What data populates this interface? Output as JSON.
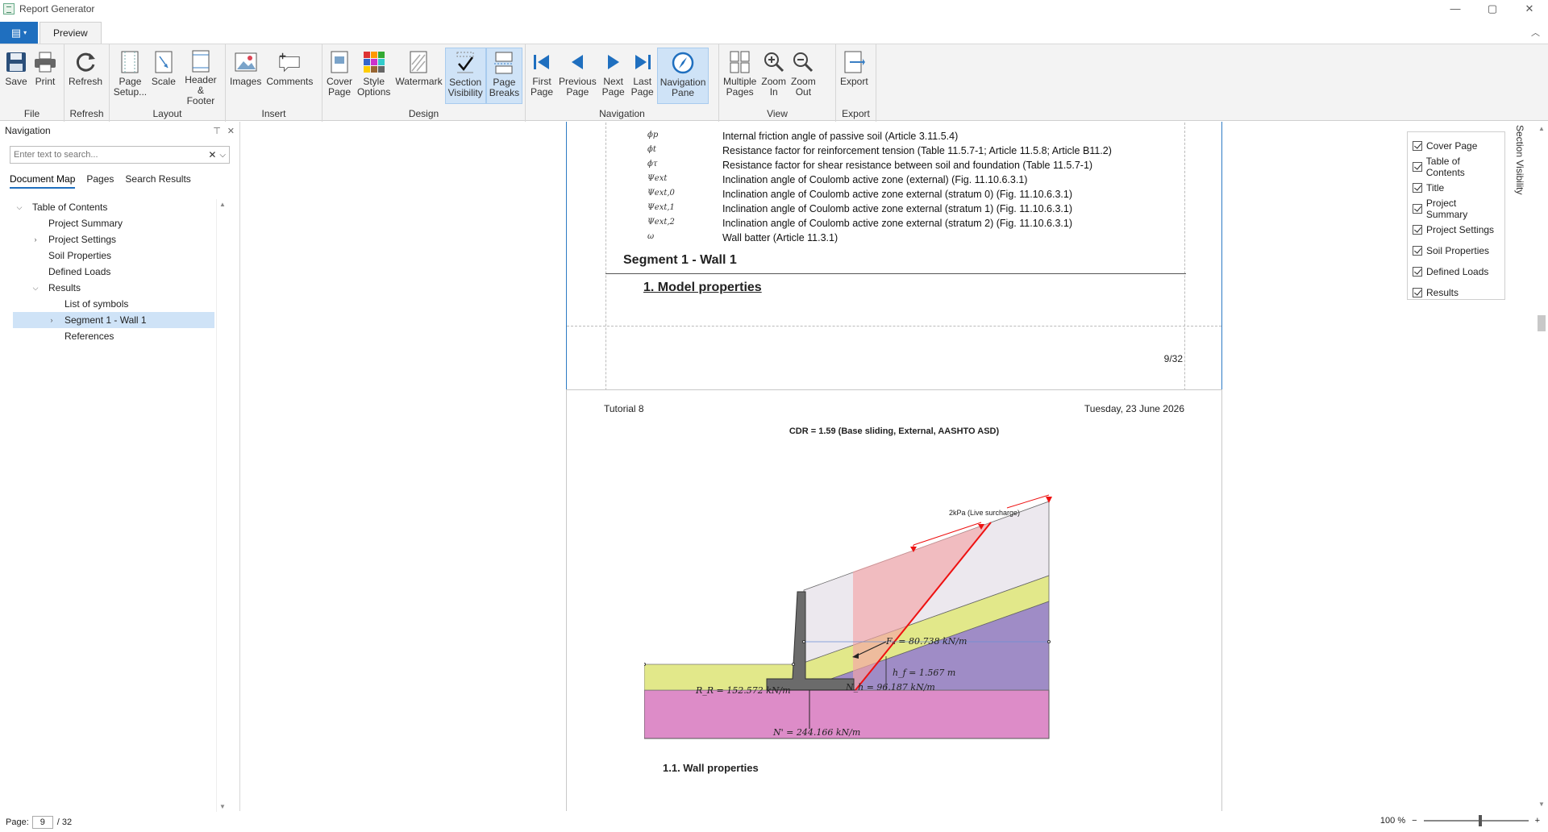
{
  "window": {
    "title": "Report Generator",
    "controls": [
      "—",
      "▢",
      "✕"
    ]
  },
  "tabs": {
    "file_icon": "▤",
    "active": "Preview"
  },
  "ribbon": {
    "groups": [
      {
        "label": "File",
        "buttons": [
          {
            "label": "Save",
            "icon": "save-icon"
          },
          {
            "label": "Print",
            "icon": "print-icon"
          }
        ]
      },
      {
        "label": "Refresh",
        "buttons": [
          {
            "label": "Refresh",
            "icon": "refresh-icon"
          }
        ]
      },
      {
        "label": "Layout",
        "buttons": [
          {
            "label": "Page\nSetup...",
            "icon": "page-setup-icon"
          },
          {
            "label": "Scale",
            "icon": "scale-icon"
          },
          {
            "label": "Header &\nFooter",
            "icon": "header-footer-icon"
          }
        ]
      },
      {
        "label": "Insert",
        "buttons": [
          {
            "label": "Images",
            "icon": "images-icon"
          },
          {
            "label": "Comments",
            "icon": "comments-icon"
          }
        ]
      },
      {
        "label": "Design",
        "buttons": [
          {
            "label": "Cover\nPage",
            "icon": "cover-page-icon"
          },
          {
            "label": "Style\nOptions",
            "icon": "style-options-icon"
          },
          {
            "label": "Watermark",
            "icon": "watermark-icon"
          },
          {
            "label": "Section\nVisibility",
            "icon": "section-visibility-icon",
            "active": true
          },
          {
            "label": "Page\nBreaks",
            "icon": "page-breaks-icon",
            "active": true
          }
        ]
      },
      {
        "label": "Navigation",
        "buttons": [
          {
            "label": "First\nPage",
            "icon": "first-page-icon"
          },
          {
            "label": "Previous\nPage",
            "icon": "previous-page-icon"
          },
          {
            "label": "Next\nPage",
            "icon": "next-page-icon"
          },
          {
            "label": "Last\nPage",
            "icon": "last-page-icon"
          },
          {
            "label": "Navigation\nPane",
            "icon": "navigation-pane-icon",
            "active": true
          }
        ]
      },
      {
        "label": "View",
        "buttons": [
          {
            "label": "Multiple\nPages",
            "icon": "multiple-pages-icon"
          },
          {
            "label": "Zoom\nIn",
            "icon": "zoom-in-icon"
          },
          {
            "label": "Zoom\nOut",
            "icon": "zoom-out-icon"
          }
        ]
      },
      {
        "label": "Export",
        "buttons": [
          {
            "label": "Export",
            "icon": "export-icon"
          }
        ]
      }
    ]
  },
  "nav": {
    "title": "Navigation",
    "search_placeholder": "Enter text to search...",
    "tabs": [
      "Document Map",
      "Pages",
      "Search Results"
    ],
    "tree": [
      {
        "label": "Table of Contents",
        "level": 0,
        "twisty": "expanded"
      },
      {
        "label": "Project Summary",
        "level": 1
      },
      {
        "label": "Project Settings",
        "level": 1,
        "twisty": "collapsed"
      },
      {
        "label": "Soil Properties",
        "level": 1
      },
      {
        "label": "Defined Loads",
        "level": 1
      },
      {
        "label": "Results",
        "level": 1,
        "twisty": "expanded"
      },
      {
        "label": "List of symbols",
        "level": 2
      },
      {
        "label": "Segment 1 - Wall 1",
        "level": 2,
        "twisty": "collapsed",
        "selected": true
      },
      {
        "label": "References",
        "level": 2
      }
    ]
  },
  "page1": {
    "symbols": [
      {
        "sym": "ϕp",
        "desc": "Internal friction angle of passive soil (Article 3.11.5.4)"
      },
      {
        "sym": "ϕt",
        "desc": "Resistance factor for reinforcement tension (Table 11.5.7-1; Article 11.5.8; Article B11.2)"
      },
      {
        "sym": "ϕτ",
        "desc": "Resistance factor for shear resistance between soil and foundation (Table 11.5.7-1)"
      },
      {
        "sym": "Ψext",
        "desc": "Inclination angle of Coulomb active zone (external) (Fig. 11.10.6.3.1)"
      },
      {
        "sym": "Ψext,0",
        "desc": "Inclination angle of Coulomb active zone external (stratum 0) (Fig. 11.10.6.3.1)"
      },
      {
        "sym": "Ψext,1",
        "desc": "Inclination angle of Coulomb active zone external (stratum 1) (Fig. 11.10.6.3.1)"
      },
      {
        "sym": "Ψext,2",
        "desc": "Inclination angle of Coulomb active zone external (stratum 2) (Fig. 11.10.6.3.1)"
      },
      {
        "sym": "ω",
        "desc": "Wall batter (Article 11.3.1)"
      }
    ],
    "segment_title": "Segment 1 - Wall 1",
    "model_title": "1.  Model properties",
    "page_number": "9/32"
  },
  "page2": {
    "header_left": "Tutorial 8",
    "header_right": "Tuesday, 23 June 2026",
    "figure_title": "CDR = 1.59 (Base sliding, External, AASHTO ASD)",
    "surcharge_label": "2kPa (Live surcharge)",
    "labels": {
      "fa": "Fₐ = 80.738 kN/m",
      "hf": "h_f = 1.567 m",
      "rr": "R_R = 152.572 kN/m",
      "nh": "N_h = 96.187 kN/m",
      "n": "N' = 244.166 kN/m"
    },
    "subsection": "1.1.  Wall properties"
  },
  "section_visibility": {
    "title": "Section Visibility",
    "items": [
      "Cover Page",
      "Table of Contents",
      "Title",
      "Project Summary",
      "Project Settings",
      "Soil Properties",
      "Defined Loads",
      "Results"
    ]
  },
  "status": {
    "page_label": "Page:",
    "page_value": "9",
    "page_total": "/ 32",
    "zoom": "100 %"
  },
  "colors": {
    "accent": "#1f6fbf",
    "selection": "#cfe3f7"
  }
}
